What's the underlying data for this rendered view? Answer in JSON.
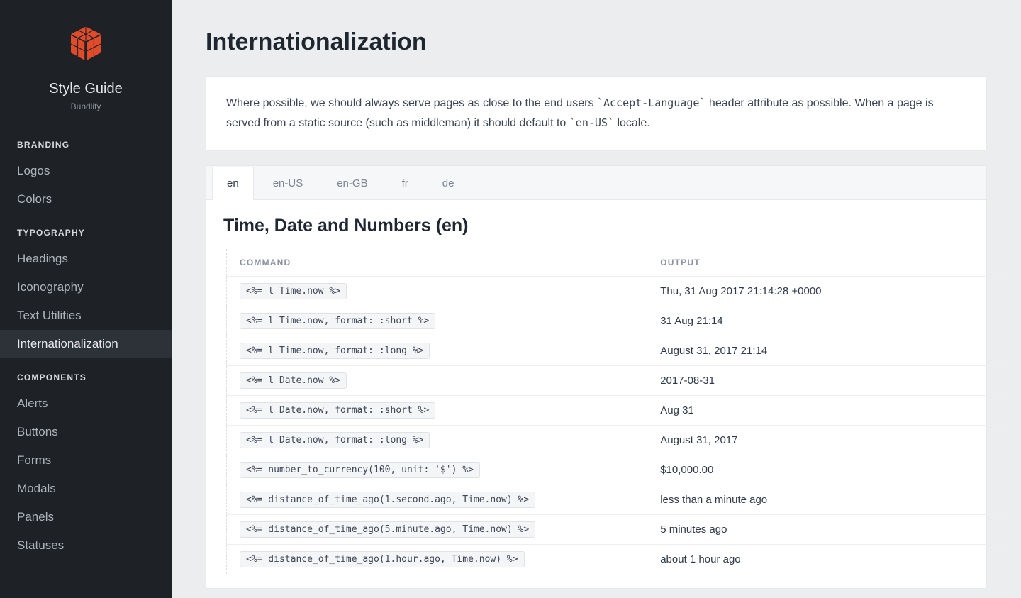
{
  "sidebar": {
    "title": "Style Guide",
    "subtitle": "Bundlify",
    "sections": [
      {
        "label": "BRANDING",
        "items": [
          {
            "name": "Logos"
          },
          {
            "name": "Colors"
          }
        ]
      },
      {
        "label": "TYPOGRAPHY",
        "items": [
          {
            "name": "Headings"
          },
          {
            "name": "Iconography"
          },
          {
            "name": "Text Utilities"
          },
          {
            "name": "Internationalization",
            "active": true
          }
        ]
      },
      {
        "label": "COMPONENTS",
        "items": [
          {
            "name": "Alerts"
          },
          {
            "name": "Buttons"
          },
          {
            "name": "Forms"
          },
          {
            "name": "Modals"
          },
          {
            "name": "Panels"
          },
          {
            "name": "Statuses"
          }
        ]
      }
    ]
  },
  "page": {
    "title": "Internationalization",
    "intro_parts": {
      "p1": "Where possible, we should always serve pages as close to the end users ",
      "code1": "`Accept-Language`",
      "p2": " header attribute as possible. When a page is served from a static source (such as middleman) it should default to ",
      "code2": "`en-US`",
      "p3": " locale."
    },
    "tabs": {
      "items": [
        {
          "label": "en",
          "active": true
        },
        {
          "label": "en-US"
        },
        {
          "label": "en-GB"
        },
        {
          "label": "fr"
        },
        {
          "label": "de"
        }
      ]
    },
    "section_heading": "Time, Date and Numbers (en)",
    "table": {
      "headers": {
        "command": "COMMAND",
        "output": "OUTPUT"
      },
      "rows": [
        {
          "command": "<%= l Time.now %>",
          "output": "Thu, 31 Aug 2017 21:14:28 +0000"
        },
        {
          "command": "<%= l Time.now, format: :short %>",
          "output": "31 Aug 21:14"
        },
        {
          "command": "<%= l Time.now, format: :long %>",
          "output": "August 31, 2017 21:14"
        },
        {
          "command": "<%= l Date.now %>",
          "output": "2017-08-31"
        },
        {
          "command": "<%= l Date.now, format: :short %>",
          "output": "Aug 31"
        },
        {
          "command": "<%= l Date.now, format: :long %>",
          "output": "August 31, 2017"
        },
        {
          "command": "<%= number_to_currency(100, unit: '$') %>",
          "output": "$10,000.00"
        },
        {
          "command": "<%= distance_of_time_ago(1.second.ago, Time.now) %>",
          "output": "less than a minute ago"
        },
        {
          "command": "<%= distance_of_time_ago(5.minute.ago, Time.now) %>",
          "output": "5 minutes ago"
        },
        {
          "command": "<%= distance_of_time_ago(1.hour.ago, Time.now) %>",
          "output": "about 1 hour ago"
        }
      ]
    }
  }
}
